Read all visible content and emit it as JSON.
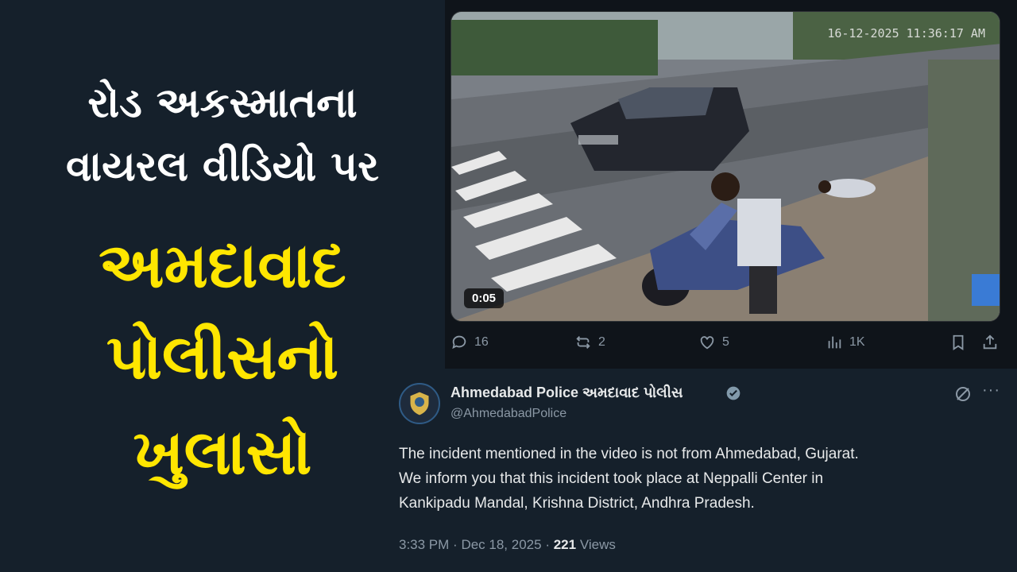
{
  "headline": {
    "line1": "રોડ અકસ્માતના",
    "line2": "વાયરલ વીડિયો પર",
    "line3": "અમદાવાદ",
    "line4": "પોલીસનો",
    "line5": "ખુલાસો"
  },
  "video": {
    "timestamp": "16-12-2025 11:36:17 AM",
    "duration": "0:05"
  },
  "actions": {
    "replies": "16",
    "reposts": "2",
    "likes": "5",
    "views": "1K"
  },
  "tweet": {
    "author_name": "Ahmedabad Police અમદાવાદ પોલીસ",
    "handle": "@AhmedabadPolice",
    "text_line1": "The incident mentioned in the video is not from Ahmedabad, Gujarat.",
    "text_line2": "We inform you that this incident took place at Neppalli Center in",
    "text_line3": "Kankipadu Mandal, Krishna District, Andhra Pradesh.",
    "time": "3:33 PM",
    "date": "Dec 18, 2025",
    "views_count": "221",
    "views_label": "Views"
  },
  "colors": {
    "background": "#15202b",
    "headline_yellow": "#ffe600",
    "headline_white": "#ffffff",
    "verified_blue": "#829aab",
    "muted_text": "#8b98a5"
  },
  "icons": [
    "reply-icon",
    "repost-icon",
    "like-icon",
    "views-icon",
    "bookmark-icon",
    "share-icon",
    "verified-icon",
    "grok-icon",
    "more-icon",
    "police-badge-icon"
  ]
}
